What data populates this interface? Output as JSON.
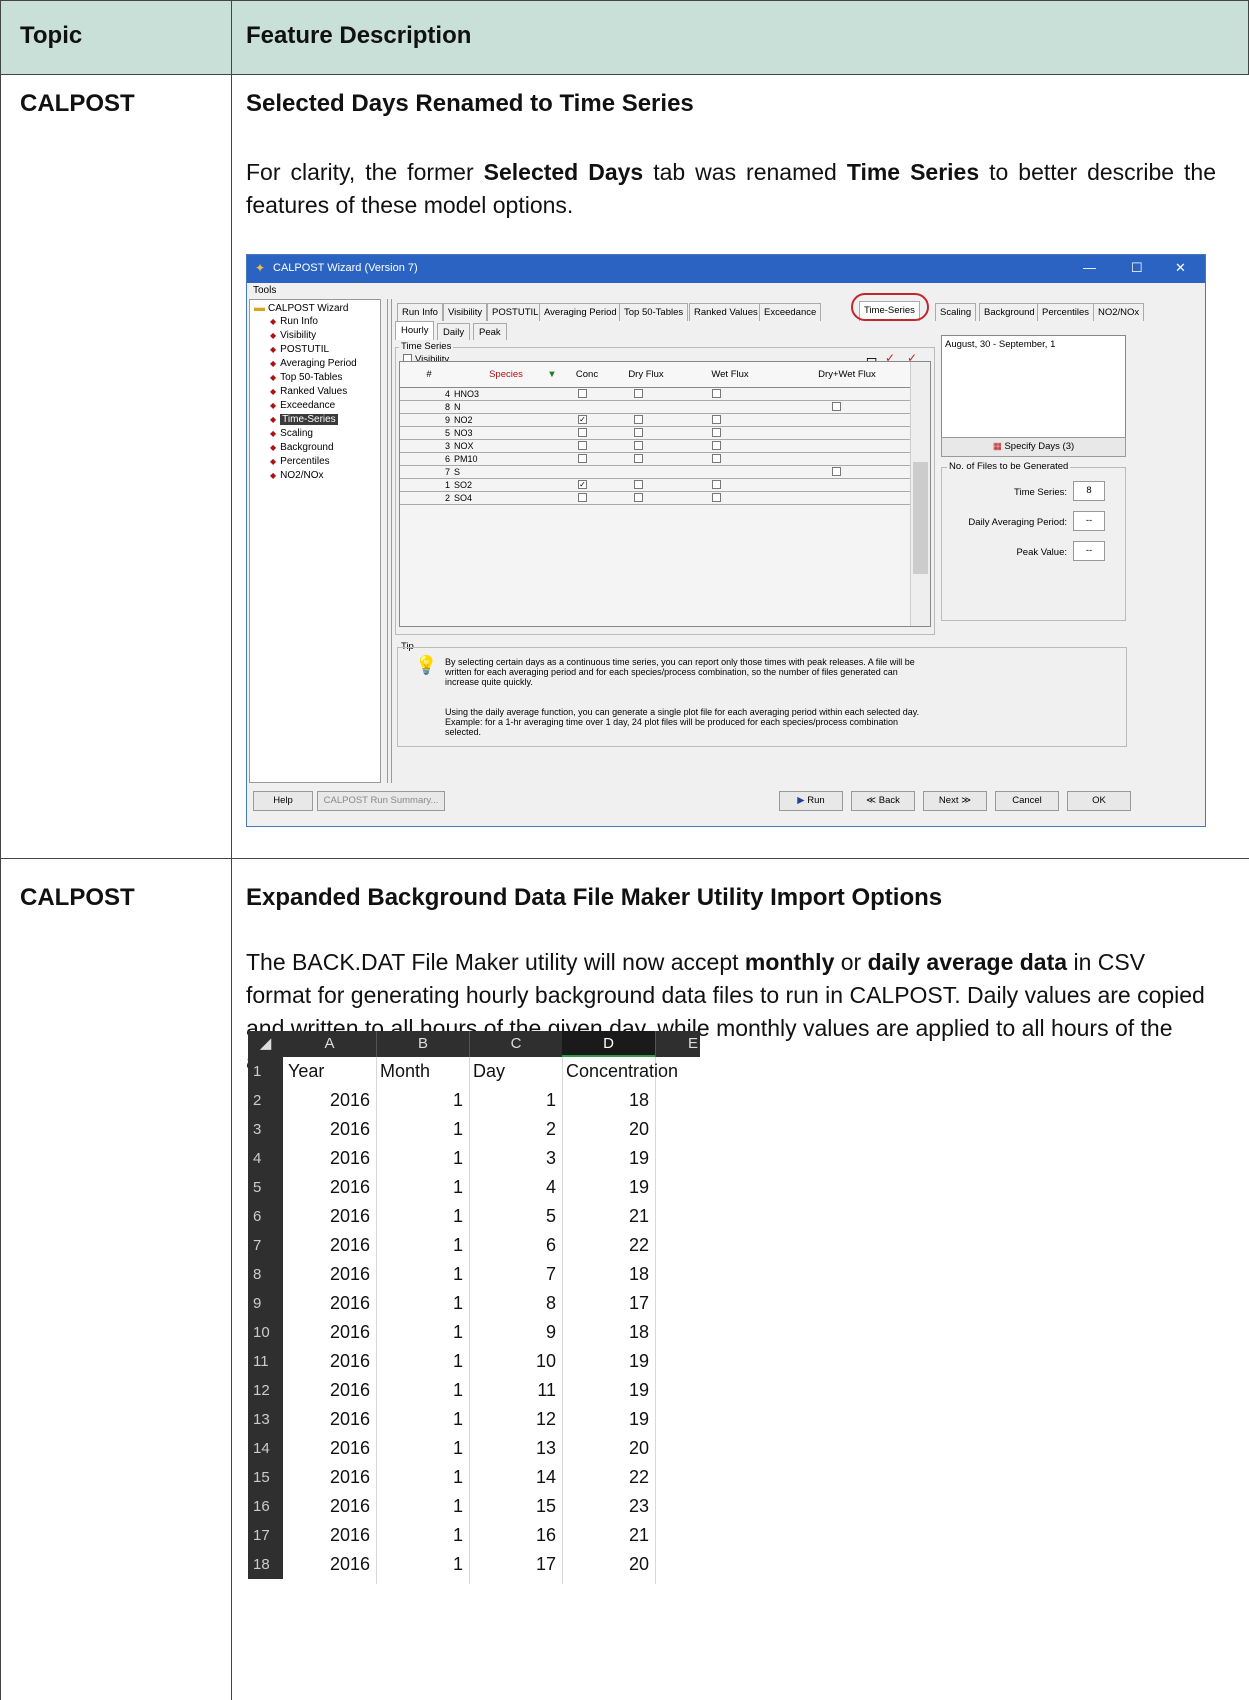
{
  "table": {
    "header": {
      "topic": "Topic",
      "feature": "Feature Description"
    },
    "rows": [
      {
        "topic": "CALPOST",
        "title": "Selected Days Renamed to Time Series",
        "para_1": "For clarity, the former ",
        "para_bold_1": "Selected Days",
        "para_2": " tab was renamed ",
        "para_bold_2": "Time Series",
        "para_3": " to better describe the features of these model options."
      },
      {
        "topic": "CALPOST",
        "title": "Expanded Background Data File Maker Utility Import Options",
        "para_1": "The BACK.DAT File Maker utility will now accept ",
        "para_bold_1": "monthly",
        "para_2": " or ",
        "para_bold_2": "daily average data",
        "para_3": " in CSV format for generating hourly background data files to run in CALPOST. Daily values are copied and written to all hours of the given day, while monthly values are applied to all hours of the assigned month."
      }
    ]
  },
  "window": {
    "title": "CALPOST Wizard (Version 7)",
    "menu": "Tools",
    "tree_root": "CALPOST Wizard",
    "tree_items": [
      "Run Info",
      "Visibility",
      "POSTUTIL",
      "Averaging Period",
      "Top 50-Tables",
      "Ranked Values",
      "Exceedance",
      "Time-Series",
      "Scaling",
      "Background",
      "Percentiles",
      "NO2/NOx"
    ],
    "tabs": [
      "Run Info",
      "Visibility",
      "POSTUTIL",
      "Averaging Period",
      "Top 50-Tables",
      "Ranked Values",
      "Exceedance",
      "Time-Series",
      "Scaling",
      "Background",
      "Percentiles",
      "NO2/NOx"
    ],
    "subtabs": [
      "Hourly",
      "Daily",
      "Peak"
    ],
    "group_time_series": "Time Series",
    "visibility_check": "Visibility",
    "grid_headers": [
      "#",
      "Species",
      "Conc",
      "Dry Flux",
      "Wet Flux",
      "Dry+Wet Flux"
    ],
    "grid_rows": [
      {
        "n": "4",
        "sp": "HNO3",
        "c": 0,
        "d": 0,
        "w": 0,
        "dw": null
      },
      {
        "n": "8",
        "sp": "N",
        "c": null,
        "d": null,
        "w": null,
        "dw": 0
      },
      {
        "n": "9",
        "sp": "NO2",
        "c": 1,
        "d": 0,
        "w": 0,
        "dw": null
      },
      {
        "n": "5",
        "sp": "NO3",
        "c": 0,
        "d": 0,
        "w": 0,
        "dw": null
      },
      {
        "n": "3",
        "sp": "NOX",
        "c": 0,
        "d": 0,
        "w": 0,
        "dw": null
      },
      {
        "n": "6",
        "sp": "PM10",
        "c": 0,
        "d": 0,
        "w": 0,
        "dw": null
      },
      {
        "n": "7",
        "sp": "S",
        "c": null,
        "d": null,
        "w": null,
        "dw": 0
      },
      {
        "n": "1",
        "sp": "SO2",
        "c": 1,
        "d": 0,
        "w": 0,
        "dw": null
      },
      {
        "n": "2",
        "sp": "SO4",
        "c": 0,
        "d": 0,
        "w": 0,
        "dw": null
      }
    ],
    "date_range": "August, 30 - September, 1",
    "specify_days": "Specify Days (3)",
    "files_group": "No. of Files  to be Generated",
    "files": [
      {
        "label": "Time Series:",
        "value": "8"
      },
      {
        "label": "Daily Averaging Period:",
        "value": "--"
      },
      {
        "label": "Peak Value:",
        "value": "--"
      }
    ],
    "tip_label": "Tip",
    "tip_1": "By selecting certain days as a continuous time series, you can report only those times with peak releases.  A file will be written for each averaging period and for each species/process combination, so the number of files generated can increase quite quickly.",
    "tip_2": "Using the daily average function, you can generate a single plot file for each averaging period within each selected day.  Example:  for a 1-hr averaging time over 1 day, 24 plot files will be produced for each species/process combination selected.",
    "buttons": {
      "help": "Help",
      "summary": "CALPOST Run Summary...",
      "run": "Run",
      "back": "Back",
      "next": "Next",
      "cancel": "Cancel",
      "ok": "OK"
    }
  },
  "sheet": {
    "cols": [
      "A",
      "B",
      "C",
      "D",
      "E"
    ],
    "headers": [
      "Year",
      "Month",
      "Day",
      "Concentration"
    ],
    "rows": [
      [
        "2016",
        "1",
        "1",
        "18"
      ],
      [
        "2016",
        "1",
        "2",
        "20"
      ],
      [
        "2016",
        "1",
        "3",
        "19"
      ],
      [
        "2016",
        "1",
        "4",
        "19"
      ],
      [
        "2016",
        "1",
        "5",
        "21"
      ],
      [
        "2016",
        "1",
        "6",
        "22"
      ],
      [
        "2016",
        "1",
        "7",
        "18"
      ],
      [
        "2016",
        "1",
        "8",
        "17"
      ],
      [
        "2016",
        "1",
        "9",
        "18"
      ],
      [
        "2016",
        "1",
        "10",
        "19"
      ],
      [
        "2016",
        "1",
        "11",
        "19"
      ],
      [
        "2016",
        "1",
        "12",
        "19"
      ],
      [
        "2016",
        "1",
        "13",
        "20"
      ],
      [
        "2016",
        "1",
        "14",
        "22"
      ],
      [
        "2016",
        "1",
        "15",
        "23"
      ],
      [
        "2016",
        "1",
        "16",
        "21"
      ],
      [
        "2016",
        "1",
        "17",
        "20"
      ]
    ]
  }
}
